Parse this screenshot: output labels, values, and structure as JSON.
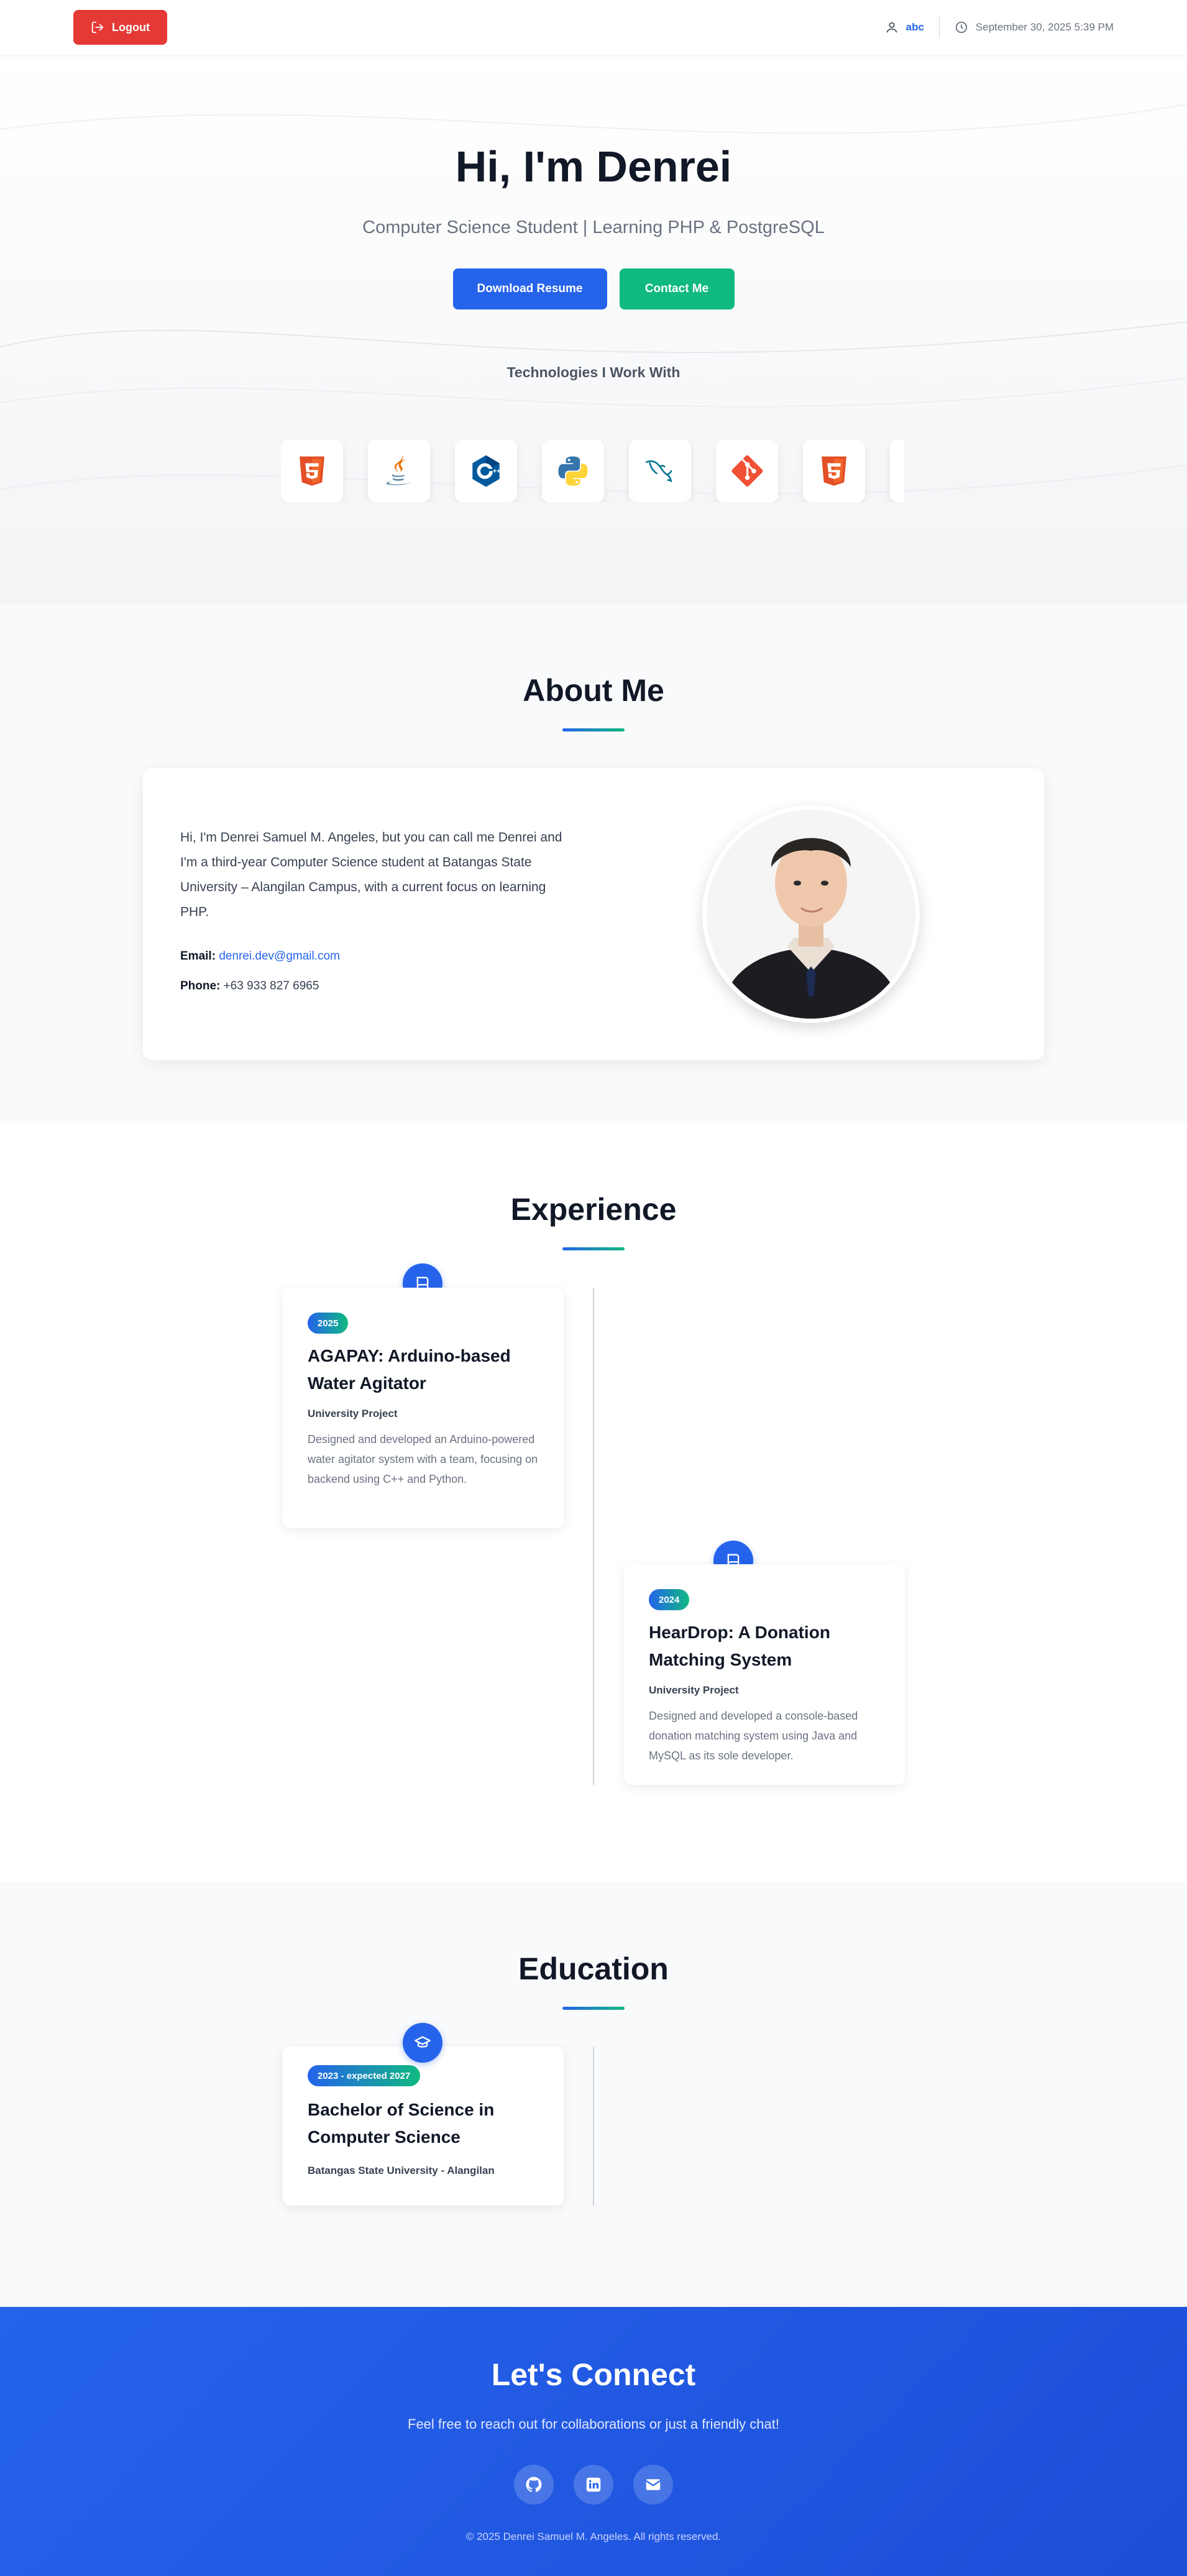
{
  "topbar": {
    "logout_label": "Logout",
    "username": "abc",
    "datetime": "September 30, 2025 5:39 PM"
  },
  "hero": {
    "title": "Hi, I'm Denrei",
    "subtitle": "Computer Science Student | Learning PHP & PostgreSQL",
    "download_label": "Download Resume",
    "contact_label": "Contact Me",
    "tech_heading": "Technologies I Work With",
    "technologies": [
      "html5-icon",
      "java-icon",
      "cplusplus-icon",
      "python-icon",
      "mysql-icon",
      "git-icon",
      "html5-icon",
      "partial-icon"
    ]
  },
  "about": {
    "title": "About Me",
    "bio": "Hi, I'm Denrei Samuel M. Angeles, but you can call me Denrei and I'm a third-year Computer Science student at Batangas State University – Alangilan Campus, with a current focus on learning PHP.",
    "email_label": "Email:",
    "email": "denrei.dev@gmail.com",
    "phone_label": "Phone:",
    "phone": "+63 933 827 6965"
  },
  "experience": {
    "title": "Experience",
    "items": [
      {
        "year": "2025",
        "title": "AGAPAY: Arduino-based Water Agitator",
        "subtitle": "University Project",
        "description": "Designed and developed an Arduino-powered water agitator system with a team, focusing on backend using C++ and Python.",
        "icon": "book-icon"
      },
      {
        "year": "2024",
        "title": "HearDrop: A Donation Matching System",
        "subtitle": "University Project",
        "description": "Designed and developed a console-based donation matching system using Java and MySQL as its sole developer.",
        "icon": "book-icon"
      }
    ]
  },
  "education": {
    "title": "Education",
    "items": [
      {
        "period": "2023 - expected 2027",
        "title": "Bachelor of Science in Computer Science",
        "subtitle": "Batangas State University - Alangilan",
        "icon": "graduation-cap-icon"
      }
    ]
  },
  "footer": {
    "title": "Let's Connect",
    "subtitle": "Feel free to reach out for collaborations or just a friendly chat!",
    "social": [
      "github-icon",
      "linkedin-icon",
      "email-icon"
    ],
    "copyright": "© 2025 Denrei Samuel M. Angeles. All rights reserved."
  },
  "colors": {
    "primary": "#2563eb",
    "success": "#10b981",
    "danger": "#e53935",
    "footer": "#1d4ed8"
  }
}
